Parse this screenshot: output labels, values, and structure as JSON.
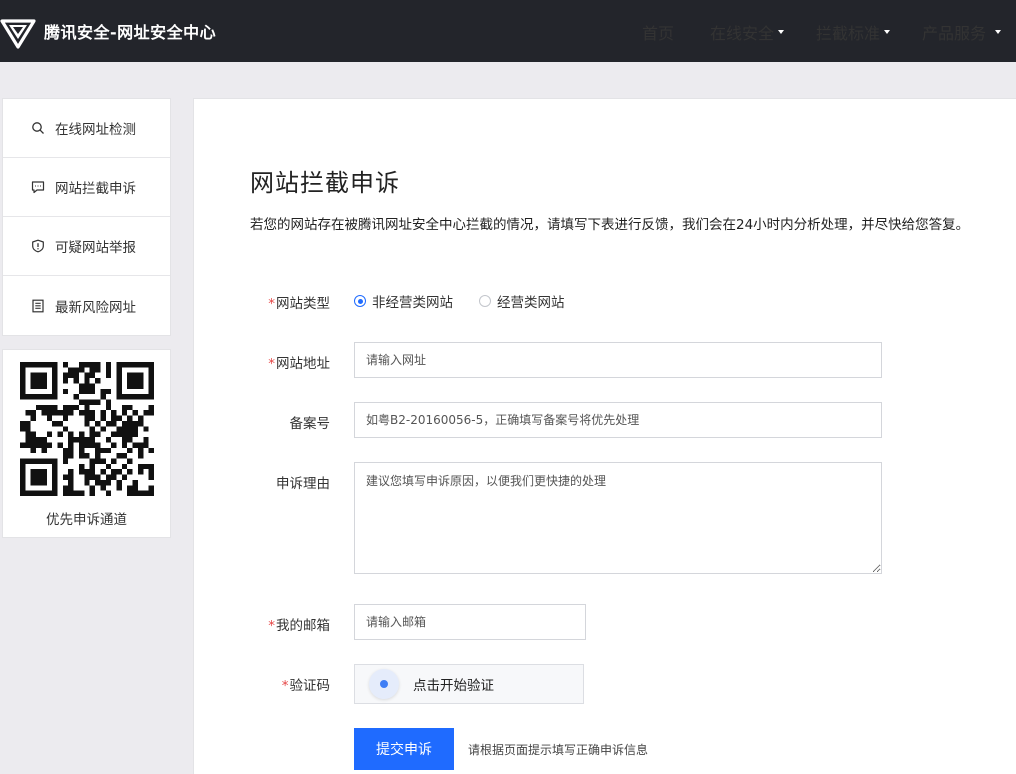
{
  "header": {
    "brand_title": "腾讯安全-网址安全中心",
    "nav": [
      {
        "label": "首页",
        "has_caret": false
      },
      {
        "label": "在线安全",
        "has_caret": true
      },
      {
        "label": "拦截标准",
        "has_caret": true
      },
      {
        "label": "产品服务",
        "has_caret": true
      }
    ]
  },
  "sidebar": {
    "items": [
      {
        "label": "在线网址检测",
        "icon": "search-icon"
      },
      {
        "label": "网站拦截申诉",
        "icon": "chat-icon"
      },
      {
        "label": "可疑网站举报",
        "icon": "shield-icon"
      },
      {
        "label": "最新风险网址",
        "icon": "document-icon"
      }
    ],
    "qr_label": "优先申诉通道"
  },
  "main": {
    "title": "网站拦截申诉",
    "description": "若您的网站存在被腾讯网址安全中心拦截的情况，请填写下表进行反馈，我们会在24小时内分析处理，并尽快给您答复。",
    "form": {
      "site_type": {
        "required_mark": "*",
        "label": "网站类型",
        "options": [
          "非经营类网站",
          "经营类网站"
        ],
        "selected": "非经营类网站"
      },
      "site_url": {
        "required_mark": "*",
        "label": "网站地址",
        "placeholder": "请输入网址"
      },
      "icp": {
        "label": "备案号",
        "placeholder": "如粤B2-20160056-5，正确填写备案号将优先处理"
      },
      "reason": {
        "label": "申诉理由",
        "placeholder": "建议您填写申诉原因，以便我们更快捷的处理"
      },
      "email": {
        "required_mark": "*",
        "label": "我的邮箱",
        "placeholder": "请输入邮箱"
      },
      "captcha": {
        "required_mark": "*",
        "label": "验证码",
        "button_text": "点击开始验证"
      },
      "submit_label": "提交申诉",
      "submit_tip": "请根据页面提示填写正确申诉信息"
    }
  },
  "colors": {
    "header_bg": "#23252b",
    "accent": "#1f6bff",
    "required": "#e54545",
    "page_bg": "#ecebef"
  }
}
